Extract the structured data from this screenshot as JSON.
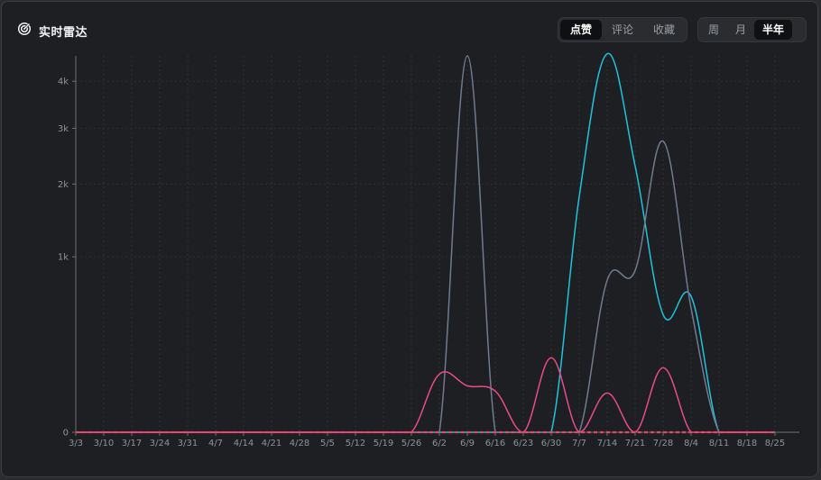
{
  "header": {
    "title": "实时雷达",
    "icon": "radar-icon",
    "metric_tabs": [
      {
        "label": "点赞",
        "active": true
      },
      {
        "label": "评论",
        "active": false
      },
      {
        "label": "收藏",
        "active": false
      }
    ],
    "range_tabs": [
      {
        "label": "周",
        "active": false
      },
      {
        "label": "月",
        "active": false
      },
      {
        "label": "半年",
        "active": true
      }
    ]
  },
  "colors": {
    "background": "#1d1f22",
    "series_cyan": "#1fc3dd",
    "series_slate": "#6f7c8e",
    "series_pink": "#e94b8c",
    "zero_line": "#e8455f"
  },
  "chart_data": {
    "type": "line",
    "x": [
      "3/3",
      "3/10",
      "3/17",
      "3/24",
      "3/31",
      "4/7",
      "4/14",
      "4/21",
      "4/28",
      "5/5",
      "5/12",
      "5/19",
      "5/26",
      "6/2",
      "6/9",
      "6/16",
      "6/23",
      "6/30",
      "7/7",
      "7/14",
      "7/21",
      "7/28",
      "8/4",
      "8/11",
      "8/18",
      "8/25"
    ],
    "yticks": [
      {
        "value": 0,
        "label": "0"
      },
      {
        "value": 1000,
        "label": "1k"
      },
      {
        "value": 2000,
        "label": "2k"
      },
      {
        "value": 3000,
        "label": "3k"
      },
      {
        "value": 4000,
        "label": "4k"
      }
    ],
    "yscale": "sqrt",
    "ylim": [
      0,
      4600
    ],
    "grid": true,
    "series": [
      {
        "color": "#1fc3dd",
        "values": [
          0,
          0,
          0,
          0,
          0,
          0,
          0,
          0,
          0,
          0,
          0,
          0,
          0,
          0,
          0,
          0,
          0,
          0,
          1800,
          4650,
          2300,
          450,
          600,
          0,
          0,
          0
        ]
      },
      {
        "color": "#6f7c8e",
        "values": [
          0,
          0,
          0,
          0,
          0,
          0,
          0,
          0,
          0,
          0,
          0,
          0,
          0,
          0,
          4600,
          0,
          0,
          0,
          0,
          750,
          850,
          2750,
          500,
          0,
          0,
          0
        ]
      },
      {
        "color": "#e94b8c",
        "values": [
          0,
          0,
          0,
          0,
          0,
          0,
          0,
          0,
          0,
          0,
          0,
          0,
          0,
          110,
          70,
          55,
          0,
          180,
          0,
          50,
          0,
          135,
          0,
          0,
          0,
          0
        ]
      }
    ]
  }
}
